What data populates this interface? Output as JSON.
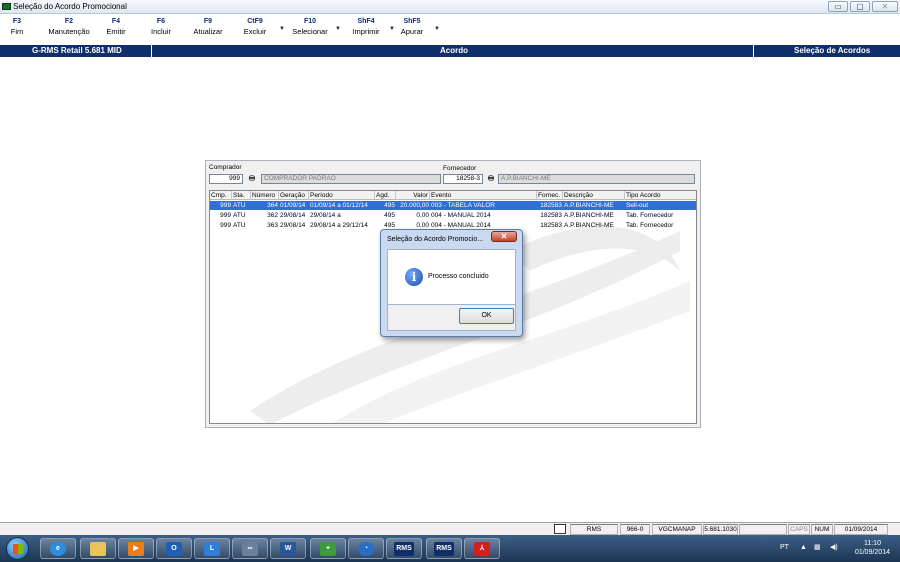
{
  "window": {
    "title": "Seleção do Acordo Promocional",
    "buttons": [
      "▭",
      "▢",
      "✕"
    ]
  },
  "toolbar": [
    {
      "key": "F3",
      "label": "Fim"
    },
    {
      "key": "F2",
      "label": "Manutenção"
    },
    {
      "key": "F4",
      "label": "Emitir"
    },
    {
      "key": "F6",
      "label": "Incluir"
    },
    {
      "key": "F9",
      "label": "Atualizar"
    },
    {
      "key": "CtF9",
      "label": "Excluir"
    },
    {
      "key": "F10",
      "label": "Selecionar"
    },
    {
      "key": "ShF4",
      "label": "Imprimir"
    },
    {
      "key": "ShF5",
      "label": "Apurar"
    }
  ],
  "header": {
    "left": "G-RMS Retail 5.681 MID",
    "center": "Acordo",
    "right": "Seleção de Acordos"
  },
  "form": {
    "comprador_label": "Comprador",
    "comprador_code": "999",
    "comprador_name": "COMPRADOR PADRAO",
    "fornecedor_label": "Fornecedor",
    "fornecedor_code": "18258-3",
    "fornecedor_name": "A.P.BIANCHI-ME"
  },
  "grid": {
    "columns": [
      "Cmp.",
      "Sta.",
      "Número",
      "Geração",
      "Período",
      "Agd.",
      "Valor",
      "Evento",
      "Fornec.",
      "Descrição",
      "Tipo Acordo"
    ],
    "rows": [
      [
        "999",
        "ATU",
        "364",
        "01/09/14",
        "01/09/14 a 01/12/14",
        "495",
        "20.000,00",
        "003 -  TABELA VALOR",
        "182583",
        "A.P.BIANCHI-ME",
        "Sell-out"
      ],
      [
        "999",
        "ATU",
        "362",
        "29/08/14",
        "29/08/14 a",
        "495",
        "0,00",
        "004 -  MANUAL 2014",
        "182583",
        "A.P.BIANCHI-ME",
        "Tab. Fornecedor"
      ],
      [
        "999",
        "ATU",
        "363",
        "29/08/14",
        "29/08/14 a 29/12/14",
        "495",
        "0,00",
        "004 -  MANUAL 2014",
        "182583",
        "A.P.BIANCHI-ME",
        "Tab. Fornecedor"
      ]
    ]
  },
  "dialog": {
    "title": "Seleção do Acordo Promocio...",
    "message": "Processo concluido",
    "ok": "OK",
    "close": "✕"
  },
  "status": {
    "c1": "RMS",
    "c2": "966-0",
    "c3": "VGCMANAP",
    "c4": "5.681.1030",
    "c5": "",
    "c6": "CAPS",
    "c7": "NUM",
    "c8": "01/09/2014"
  },
  "taskbar": {
    "apps": [
      "ie",
      "explorer",
      "media-player",
      "outlook",
      "lync",
      "app",
      "word",
      "app2",
      "app3",
      "rms",
      "rms",
      "pdf"
    ],
    "app_labels": {
      "rms": "RMS"
    },
    "tray_lang": "PT",
    "time": "11:10",
    "date": "01/09/2014"
  },
  "colors": {
    "header_bg": "#0f2e6b",
    "selected_row": "#2f6fd6",
    "taskbar": "#2a4768"
  }
}
